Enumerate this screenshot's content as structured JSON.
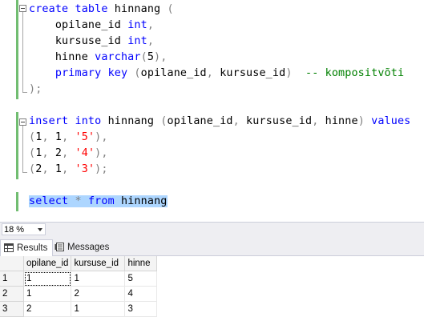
{
  "editor": {
    "lines": [
      [
        {
          "t": "create",
          "c": "kw"
        },
        {
          "t": " "
        },
        {
          "t": "table",
          "c": "kw"
        },
        {
          "t": " hinnang "
        },
        {
          "t": "(",
          "c": "op"
        }
      ],
      [
        {
          "t": "    opilane_id "
        },
        {
          "t": "int",
          "c": "kw"
        },
        {
          "t": ",",
          "c": "op"
        }
      ],
      [
        {
          "t": "    kursuse_id "
        },
        {
          "t": "int",
          "c": "kw"
        },
        {
          "t": ",",
          "c": "op"
        }
      ],
      [
        {
          "t": "    hinne "
        },
        {
          "t": "varchar",
          "c": "kw"
        },
        {
          "t": "(",
          "c": "op"
        },
        {
          "t": "5"
        },
        {
          "t": "),",
          "c": "op"
        }
      ],
      [
        {
          "t": "    "
        },
        {
          "t": "primary",
          "c": "kw"
        },
        {
          "t": " "
        },
        {
          "t": "key",
          "c": "kw"
        },
        {
          "t": " "
        },
        {
          "t": "(",
          "c": "op"
        },
        {
          "t": "opilane_id"
        },
        {
          "t": ",",
          "c": "op"
        },
        {
          "t": " kursuse_id"
        },
        {
          "t": ")",
          "c": "op"
        },
        {
          "t": "  "
        },
        {
          "t": "-- kompositvõti",
          "c": "cm"
        }
      ],
      [
        {
          "t": ");",
          "c": "op"
        }
      ],
      [],
      [
        {
          "t": "insert",
          "c": "kw"
        },
        {
          "t": " "
        },
        {
          "t": "into",
          "c": "kw"
        },
        {
          "t": " hinnang "
        },
        {
          "t": "(",
          "c": "op"
        },
        {
          "t": "opilane_id"
        },
        {
          "t": ",",
          "c": "op"
        },
        {
          "t": " kursuse_id"
        },
        {
          "t": ",",
          "c": "op"
        },
        {
          "t": " hinne"
        },
        {
          "t": ")",
          "c": "op"
        },
        {
          "t": " "
        },
        {
          "t": "values",
          "c": "kw"
        }
      ],
      [
        {
          "t": "(",
          "c": "op"
        },
        {
          "t": "1"
        },
        {
          "t": ",",
          "c": "op"
        },
        {
          "t": " 1"
        },
        {
          "t": ",",
          "c": "op"
        },
        {
          "t": " "
        },
        {
          "t": "'5'",
          "c": "str"
        },
        {
          "t": "),",
          "c": "op"
        }
      ],
      [
        {
          "t": "(",
          "c": "op"
        },
        {
          "t": "1"
        },
        {
          "t": ",",
          "c": "op"
        },
        {
          "t": " 2"
        },
        {
          "t": ",",
          "c": "op"
        },
        {
          "t": " "
        },
        {
          "t": "'4'",
          "c": "str"
        },
        {
          "t": "),",
          "c": "op"
        }
      ],
      [
        {
          "t": "(",
          "c": "op"
        },
        {
          "t": "2"
        },
        {
          "t": ",",
          "c": "op"
        },
        {
          "t": " 1"
        },
        {
          "t": ",",
          "c": "op"
        },
        {
          "t": " "
        },
        {
          "t": "'3'",
          "c": "str"
        },
        {
          "t": ");",
          "c": "op"
        }
      ],
      [],
      [
        {
          "t": "select",
          "c": "kw sel"
        },
        {
          "t": " ",
          "c": "sel"
        },
        {
          "t": "*",
          "c": "op sel"
        },
        {
          "t": " ",
          "c": "sel"
        },
        {
          "t": "from",
          "c": "kw sel"
        },
        {
          "t": " hinnang",
          "c": "sel"
        }
      ]
    ]
  },
  "zoom": {
    "value": "18 %"
  },
  "tabs": {
    "results_label": "Results",
    "messages_label": "Messages"
  },
  "results": {
    "columns": [
      "opilane_id",
      "kursuse_id",
      "hinne"
    ],
    "rows": [
      {
        "num": "1",
        "cells": [
          "1",
          "1",
          "5"
        ]
      },
      {
        "num": "2",
        "cells": [
          "1",
          "2",
          "4"
        ]
      },
      {
        "num": "3",
        "cells": [
          "2",
          "1",
          "3"
        ]
      }
    ]
  },
  "colors": {
    "keyword": "#0000ff",
    "string": "#ff0000",
    "comment": "#008000",
    "operator": "#808080",
    "selection": "#add6ff",
    "change_bar": "#71bd71"
  }
}
